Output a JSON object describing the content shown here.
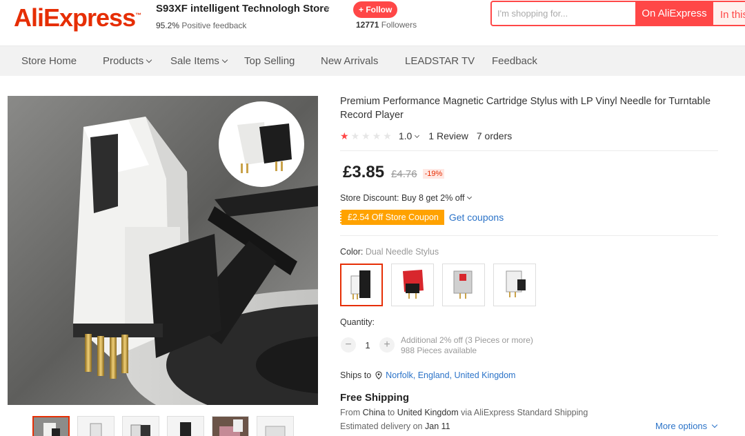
{
  "header": {
    "logo": "AliExpress",
    "store_name": "S93XF intelligent Technologh Store",
    "feedback_pct": "95.2%",
    "feedback_label": "Positive feedback",
    "follow_label": "+ Follow",
    "followers_count": "12771",
    "followers_label": "Followers",
    "search_placeholder": "I'm shopping for...",
    "search_main_label": "On AliExpress",
    "search_store_label": "In this store"
  },
  "nav": {
    "items": [
      {
        "label": "Store Home"
      },
      {
        "label": "Products"
      },
      {
        "label": "Sale Items"
      },
      {
        "label": "Top Selling"
      },
      {
        "label": "New Arrivals"
      },
      {
        "label": "LEADSTAR TV"
      },
      {
        "label": "Feedback"
      }
    ]
  },
  "product": {
    "title": "Premium Performance Magnetic Cartridge Stylus with LP Vinyl Needle for Turntable Record Player",
    "rating": {
      "value": "1.0",
      "stars_filled": 1,
      "stars_total": 5,
      "reviews": "1 Review",
      "orders": "7 orders"
    },
    "price": "£3.85",
    "original_price": "£4.76",
    "discount": "-19%",
    "store_discount_label": "Store Discount:",
    "store_discount_text": "Buy 8 get 2% off",
    "coupon_badge": "£2.54 Off Store Coupon",
    "get_coupons": "Get coupons",
    "color_label": "Color:",
    "color_value": "Dual Needle Stylus",
    "quantity_label": "Quantity:",
    "quantity_value": "1",
    "qty_minus": "−",
    "qty_plus": "+",
    "qty_discount": "Additional 2% off (3 Pieces or more)",
    "qty_available": "988 Pieces available",
    "ships_to_label": "Ships to",
    "ships_to_location": "Norfolk, England, United Kingdom",
    "free_shipping": "Free Shipping",
    "ship_from_prefix": "From",
    "ship_from_country": "China",
    "ship_to_word": "to",
    "ship_to_country": "United Kingdom",
    "ship_via": "via AliExpress Standard Shipping",
    "delivery_prefix": "Estimated delivery on",
    "delivery_date": "Jan 11",
    "more_options": "More options"
  },
  "colors": {
    "brand": "#e62e04",
    "accent": "#ff4747",
    "link": "#2b73c8",
    "coupon": "#ffa200"
  }
}
